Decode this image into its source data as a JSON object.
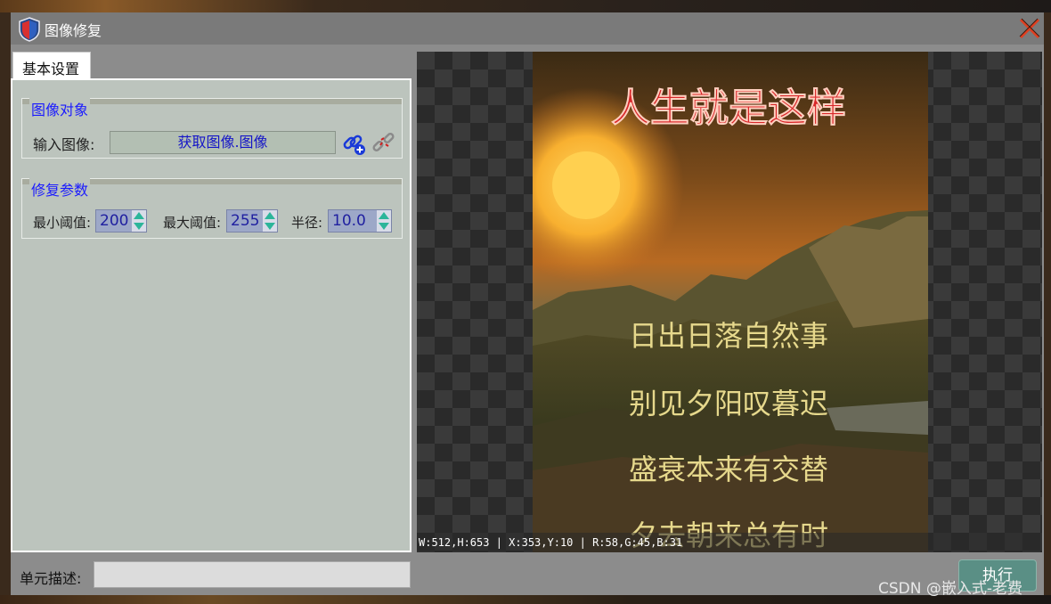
{
  "window": {
    "title": "图像修复"
  },
  "tabs": [
    {
      "label": "基本设置"
    }
  ],
  "image_object": {
    "group_title": "图像对象",
    "input_label": "输入图像:",
    "source_button": "获取图像.图像"
  },
  "repair_params": {
    "group_title": "修复参数",
    "min_threshold": {
      "label": "最小阈值:",
      "value": "200"
    },
    "max_threshold": {
      "label": "最大阈值:",
      "value": "255"
    },
    "radius": {
      "label": "半径:",
      "value": "10.0"
    }
  },
  "description": {
    "label": "单元描述:",
    "value": ""
  },
  "preview": {
    "poem_title": "人生就是这样",
    "poem_lines": [
      "日出日落自然事",
      "别见夕阳叹暮迟",
      "盛衰本来有交替",
      "夕去朝来总有时"
    ],
    "status_text": "W:512,H:653 | X:353,Y:10 | R:58,G:45,B:31"
  },
  "execute_button": "执行",
  "watermark": "CSDN @嵌入式-老费"
}
